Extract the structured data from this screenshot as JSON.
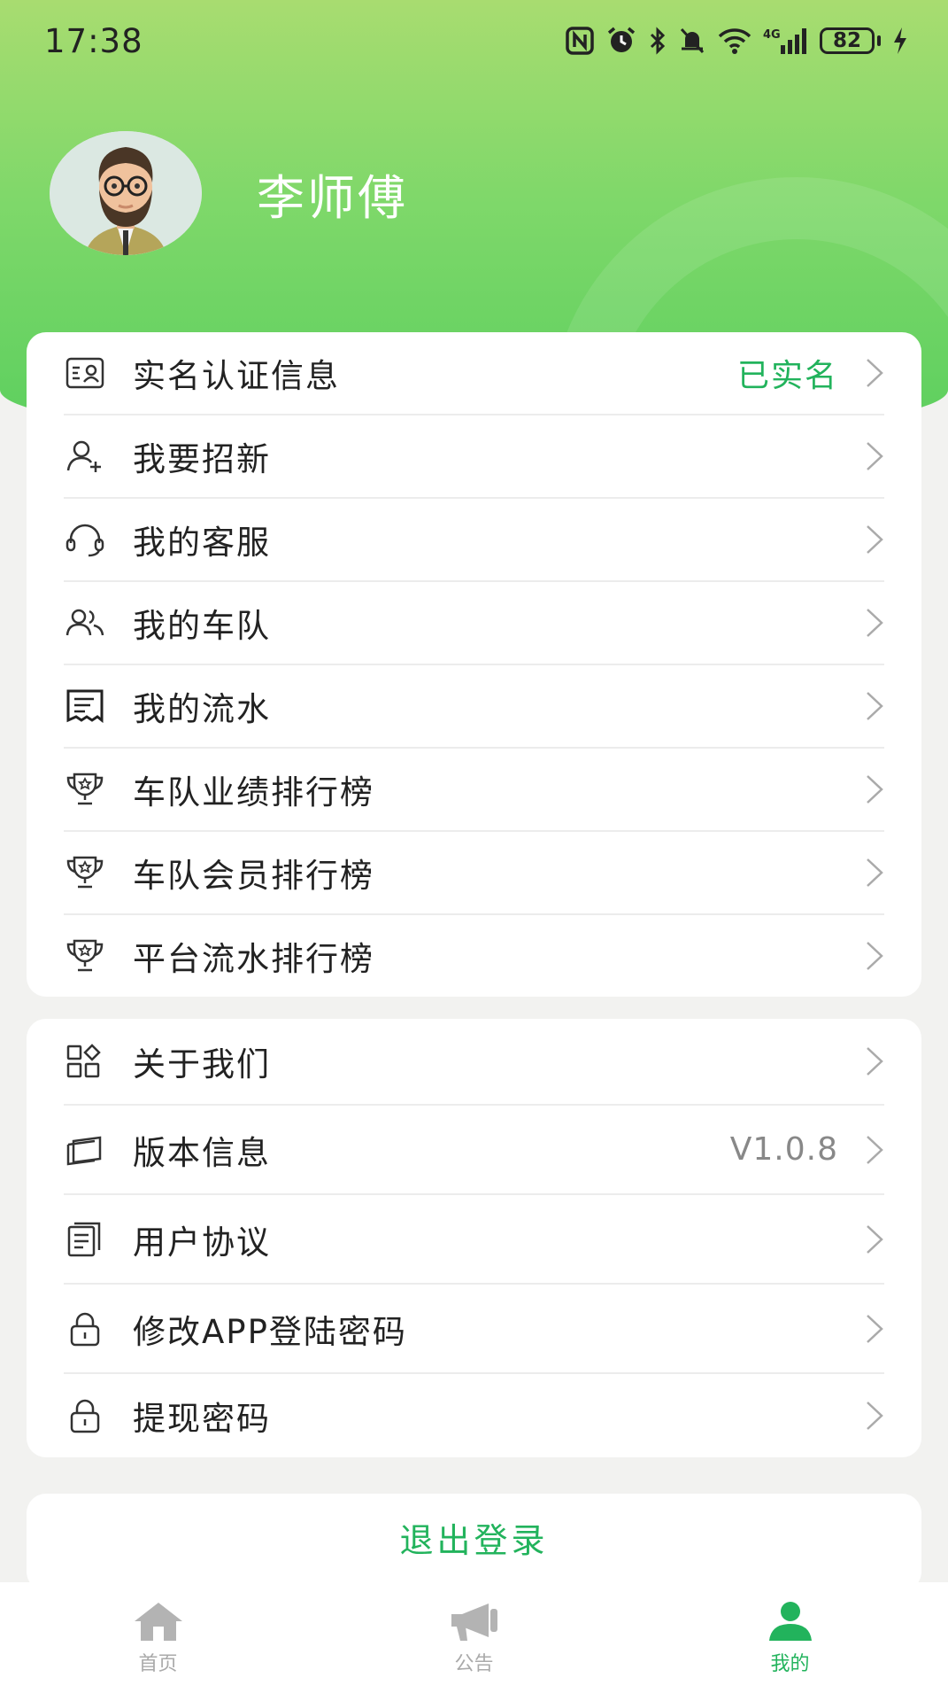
{
  "status_bar": {
    "time": "17:38",
    "battery": "82"
  },
  "profile": {
    "name": "李师傅"
  },
  "menu_primary": [
    {
      "label": "实名认证信息",
      "value": "已实名",
      "icon": "id-card-icon"
    },
    {
      "label": "我要招新",
      "value": "",
      "icon": "user-add-icon"
    },
    {
      "label": "我的客服",
      "value": "",
      "icon": "headset-icon"
    },
    {
      "label": "我的车队",
      "value": "",
      "icon": "team-icon"
    },
    {
      "label": "我的流水",
      "value": "",
      "icon": "receipt-icon"
    },
    {
      "label": "车队业绩排行榜",
      "value": "",
      "icon": "trophy-icon"
    },
    {
      "label": "车队会员排行榜",
      "value": "",
      "icon": "trophy-icon"
    },
    {
      "label": "平台流水排行榜",
      "value": "",
      "icon": "trophy-icon"
    }
  ],
  "menu_secondary": [
    {
      "label": "关于我们",
      "value": "",
      "icon": "apps-icon"
    },
    {
      "label": "版本信息",
      "value": "V1.0.8",
      "icon": "layers-icon"
    },
    {
      "label": "用户协议",
      "value": "",
      "icon": "document-icon"
    },
    {
      "label": "修改APP登陆密码",
      "value": "",
      "icon": "lock-icon"
    },
    {
      "label": "提现密码",
      "value": "",
      "icon": "lock-icon"
    }
  ],
  "logout": {
    "label": "退出登录"
  },
  "tabbar": [
    {
      "label": "首页",
      "icon": "home-icon",
      "active": false
    },
    {
      "label": "公告",
      "icon": "megaphone-icon",
      "active": false
    },
    {
      "label": "我的",
      "icon": "user-icon",
      "active": true
    }
  ],
  "colors": {
    "accent": "#22b35c",
    "header_top": "#a8dc70",
    "header_bottom": "#5bcf5e"
  }
}
